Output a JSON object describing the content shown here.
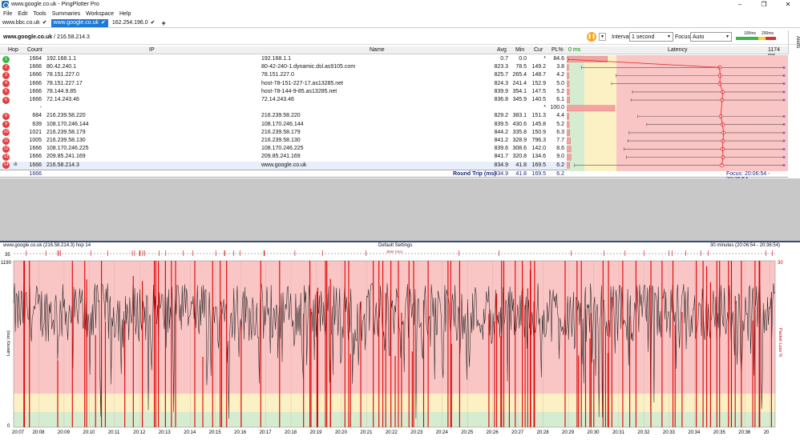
{
  "window": {
    "title": "www.google.co.uk - PingPlotter Pro",
    "controls": [
      "–",
      "❐",
      "✕"
    ]
  },
  "menu": [
    "File",
    "Edit",
    "Tools",
    "Summaries",
    "Workspace",
    "Help"
  ],
  "tabs": [
    {
      "label": "www.bbc.co.uk",
      "active": false
    },
    {
      "label": "www.google.co.uk",
      "active": true
    },
    {
      "label": "162.254.196.0",
      "active": false
    }
  ],
  "target": {
    "host": "www.google.co.uk",
    "ip": "/ 216.58.214.3"
  },
  "toolbar": {
    "interval_label": "Interval",
    "interval_value": "1 second",
    "focus_label": "Focus",
    "focus_value": "Auto",
    "scale_100": "100ms",
    "scale_200": "200ms",
    "alerts_label": "Alerts"
  },
  "table": {
    "headers": {
      "hop": "Hop",
      "count": "Count",
      "ip": "IP",
      "name": "Name",
      "avg": "Avg",
      "min": "Min",
      "cur": "Cur",
      "pl": "PL%",
      "ms0": "0 ms",
      "latency": "Latency",
      "msmax": "1174 ms"
    },
    "rows": [
      {
        "hop": "1",
        "count": "1664",
        "ip": "192.168.1.1",
        "name": "192.168.1.1",
        "avg": "0.7",
        "min": "0.0",
        "cur": "*",
        "pl": "84.6",
        "status": "green",
        "min_ms": 0,
        "avg_ms": 0.7,
        "max_ms": 2
      },
      {
        "hop": "2",
        "count": "1666",
        "ip": "80.42.240.1",
        "name": "80-42-240-1.dynamic.dsl.as9105.com",
        "avg": "823.3",
        "min": "78.5",
        "cur": "149.2",
        "pl": "3.8",
        "status": "red",
        "min_ms": 78.5,
        "avg_ms": 823.3,
        "max_ms": 1174
      },
      {
        "hop": "3",
        "count": "1666",
        "ip": "78.151.227.0",
        "name": "78.151.227.0",
        "avg": "825.7",
        "min": "265.4",
        "cur": "148.7",
        "pl": "4.2",
        "status": "red",
        "min_ms": 265.4,
        "avg_ms": 825.7,
        "max_ms": 1174
      },
      {
        "hop": "4",
        "count": "1666",
        "ip": "78.151.227.17",
        "name": "host-78-151-227-17.as13285.net",
        "avg": "824.3",
        "min": "241.4",
        "cur": "152.9",
        "pl": "5.0",
        "status": "red",
        "min_ms": 241.4,
        "avg_ms": 824.3,
        "max_ms": 1174
      },
      {
        "hop": "5",
        "count": "1666",
        "ip": "78.144.9.85",
        "name": "host-78-144-9-85.as13285.net",
        "avg": "839.9",
        "min": "354.1",
        "cur": "147.5",
        "pl": "5.2",
        "status": "red",
        "min_ms": 354.1,
        "avg_ms": 839.9,
        "max_ms": 1174
      },
      {
        "hop": "6",
        "count": "1666",
        "ip": "72.14.243.46",
        "name": "72.14.243.46",
        "avg": "836.8",
        "min": "345.9",
        "cur": "140.5",
        "pl": "6.1",
        "status": "red",
        "min_ms": 345.9,
        "avg_ms": 836.8,
        "max_ms": 1174
      },
      {
        "hop": "7",
        "count": "-",
        "ip": "",
        "name": "",
        "avg": "",
        "min": "",
        "cur": "*",
        "pl": "100.0",
        "status": "none"
      },
      {
        "hop": "8",
        "count": "684",
        "ip": "216.239.58.220",
        "name": "216.239.58.220",
        "avg": "829.2",
        "min": "383.1",
        "cur": "151.3",
        "pl": "4.4",
        "status": "red",
        "min_ms": 383.1,
        "avg_ms": 829.2,
        "max_ms": 1174
      },
      {
        "hop": "9",
        "count": "639",
        "ip": "108.170.246.144",
        "name": "108.170.246.144",
        "avg": "839.5",
        "min": "430.6",
        "cur": "145.8",
        "pl": "5.2",
        "status": "red",
        "min_ms": 430.6,
        "avg_ms": 839.5,
        "max_ms": 1174
      },
      {
        "hop": "10",
        "count": "1021",
        "ip": "216.239.58.179",
        "name": "216.239.58.179",
        "avg": "844.2",
        "min": "335.8",
        "cur": "150.9",
        "pl": "6.3",
        "status": "red",
        "min_ms": 335.8,
        "avg_ms": 844.2,
        "max_ms": 1174
      },
      {
        "hop": "11",
        "count": "1005",
        "ip": "216.239.58.130",
        "name": "216.239.58.130",
        "avg": "841.2",
        "min": "328.9",
        "cur": "796.3",
        "pl": "7.7",
        "status": "red",
        "min_ms": 328.9,
        "avg_ms": 841.2,
        "max_ms": 1174
      },
      {
        "hop": "12",
        "count": "1666",
        "ip": "108.170.246.225",
        "name": "108.170.246.225",
        "avg": "839.6",
        "min": "308.6",
        "cur": "142.0",
        "pl": "8.6",
        "status": "red",
        "min_ms": 308.6,
        "avg_ms": 839.6,
        "max_ms": 1174
      },
      {
        "hop": "13",
        "count": "1666",
        "ip": "209.85.241.169",
        "name": "209.85.241.169",
        "avg": "841.7",
        "min": "320.8",
        "cur": "134.6",
        "pl": "9.0",
        "status": "red",
        "min_ms": 320.8,
        "avg_ms": 841.7,
        "max_ms": 1174
      },
      {
        "hop": "14",
        "count": "1666",
        "ip": "216.58.214.3",
        "name": "www.google.co.uk",
        "avg": "834.9",
        "min": "41.8",
        "cur": "169.5",
        "pl": "6.2",
        "status": "red",
        "selected": true,
        "min_ms": 41.8,
        "avg_ms": 834.9,
        "max_ms": 1174
      }
    ],
    "round_trip": {
      "count": "1666",
      "label": "Round Trip (ms)",
      "avg": "834.9",
      "min": "41.8",
      "cur": "169.5",
      "pl": "6.2",
      "focus": "Focus: 20:06:54 - 20:36:54"
    }
  },
  "graph": {
    "title_left": "www.google.co.uk (216.58.214.3) hop 14",
    "title_center": "Default Settings",
    "title_right": "30 minutes (20:06:54 - 20:36:54)",
    "jitter_label": "Jitter (ms)",
    "jitter_max": "35",
    "y_max": "1190",
    "y_min": "0",
    "pl_max": "30",
    "y_label": "Latency (ms)",
    "pl_label": "Packet Loss %",
    "times": [
      "20:07",
      "20:08",
      "20:09",
      "20:10",
      "20:11",
      "20:12",
      "20:13",
      "20:14",
      "20:15",
      "20:16",
      "20:17",
      "20:18",
      "20:19",
      "20:20",
      "20:21",
      "20:22",
      "20:23",
      "20:24",
      "20:25",
      "20:26",
      "20:27",
      "20:28",
      "20:29",
      "20:30",
      "20:31",
      "20:32",
      "20:33",
      "20:34",
      "20:35",
      "20:36",
      "20"
    ]
  },
  "colors": {
    "accent": "#1e78d7",
    "red_zone": "#f9c5c5",
    "yellow_zone": "#fbf1c4",
    "green_zone": "#d5ecd0",
    "loss_line": "#e00000"
  }
}
